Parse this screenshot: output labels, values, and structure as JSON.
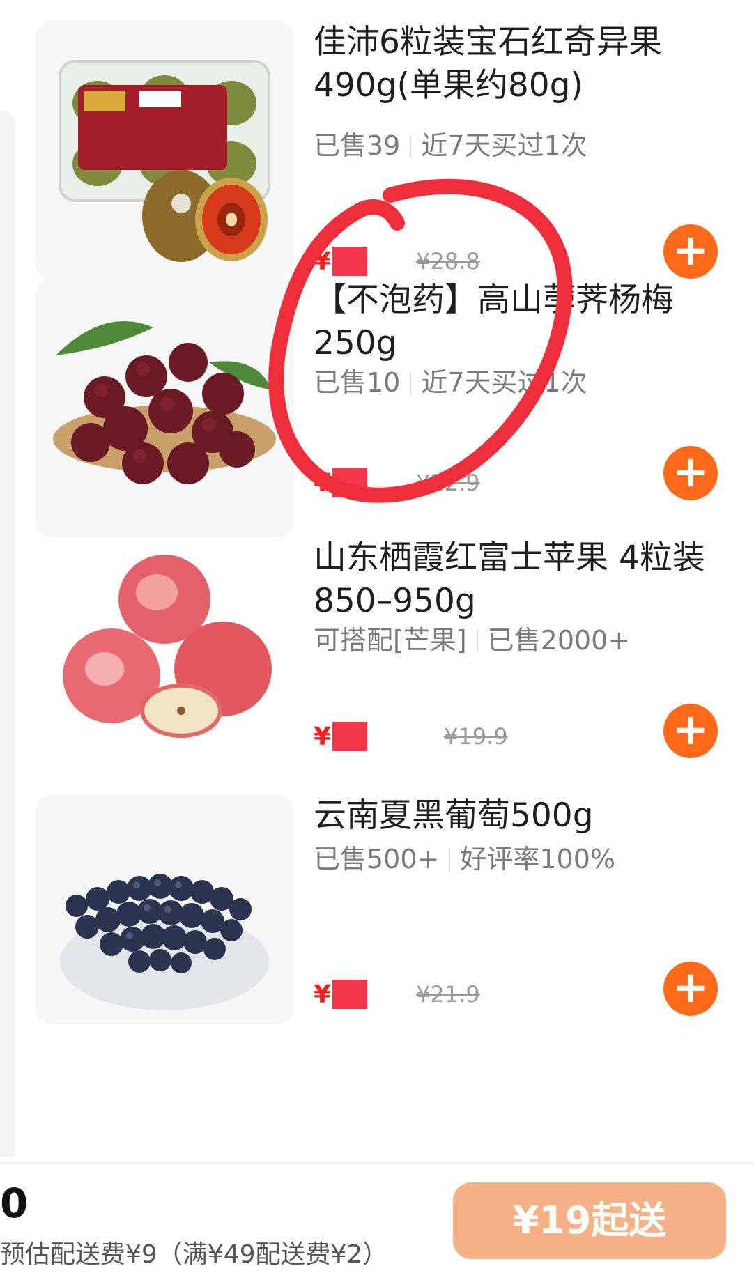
{
  "products": [
    {
      "title": "佳沛6粒装宝石红奇异果490g(单果约80g)",
      "meta": [
        "已售39",
        "近7天买过1次"
      ],
      "price_symbol": "¥",
      "original_price": "¥28.8",
      "image": "kiwi-box-image"
    },
    {
      "title": "【不泡药】高山荸荠杨梅250g",
      "meta": [
        "已售10",
        "近7天买过1次"
      ],
      "price_symbol": "¥",
      "original_price": "¥22.9",
      "image": "bayberry-image"
    },
    {
      "title": "山东栖霞红富士苹果 4粒装850–950g",
      "meta": [
        "可搭配[芒果]",
        "已售2000+"
      ],
      "price_symbol": "¥",
      "original_price": "¥19.9",
      "image": "apple-image"
    },
    {
      "title": "云南夏黑葡萄500g",
      "meta": [
        "已售500+",
        "好评率100%"
      ],
      "price_symbol": "¥",
      "original_price": "¥21.9",
      "image": "grape-image"
    }
  ],
  "add_button_label": "+",
  "bottom_bar": {
    "cart_amount": "0",
    "delivery_fee_note": "预估配送费¥9（满¥49配送费¥2）",
    "checkout_label": "¥19起送"
  },
  "colors": {
    "accent_orange": "#ff6a1a",
    "checkout_disabled": "#f7b186",
    "annotation_red": "#ee2f3b",
    "price_red": "#f02020"
  }
}
